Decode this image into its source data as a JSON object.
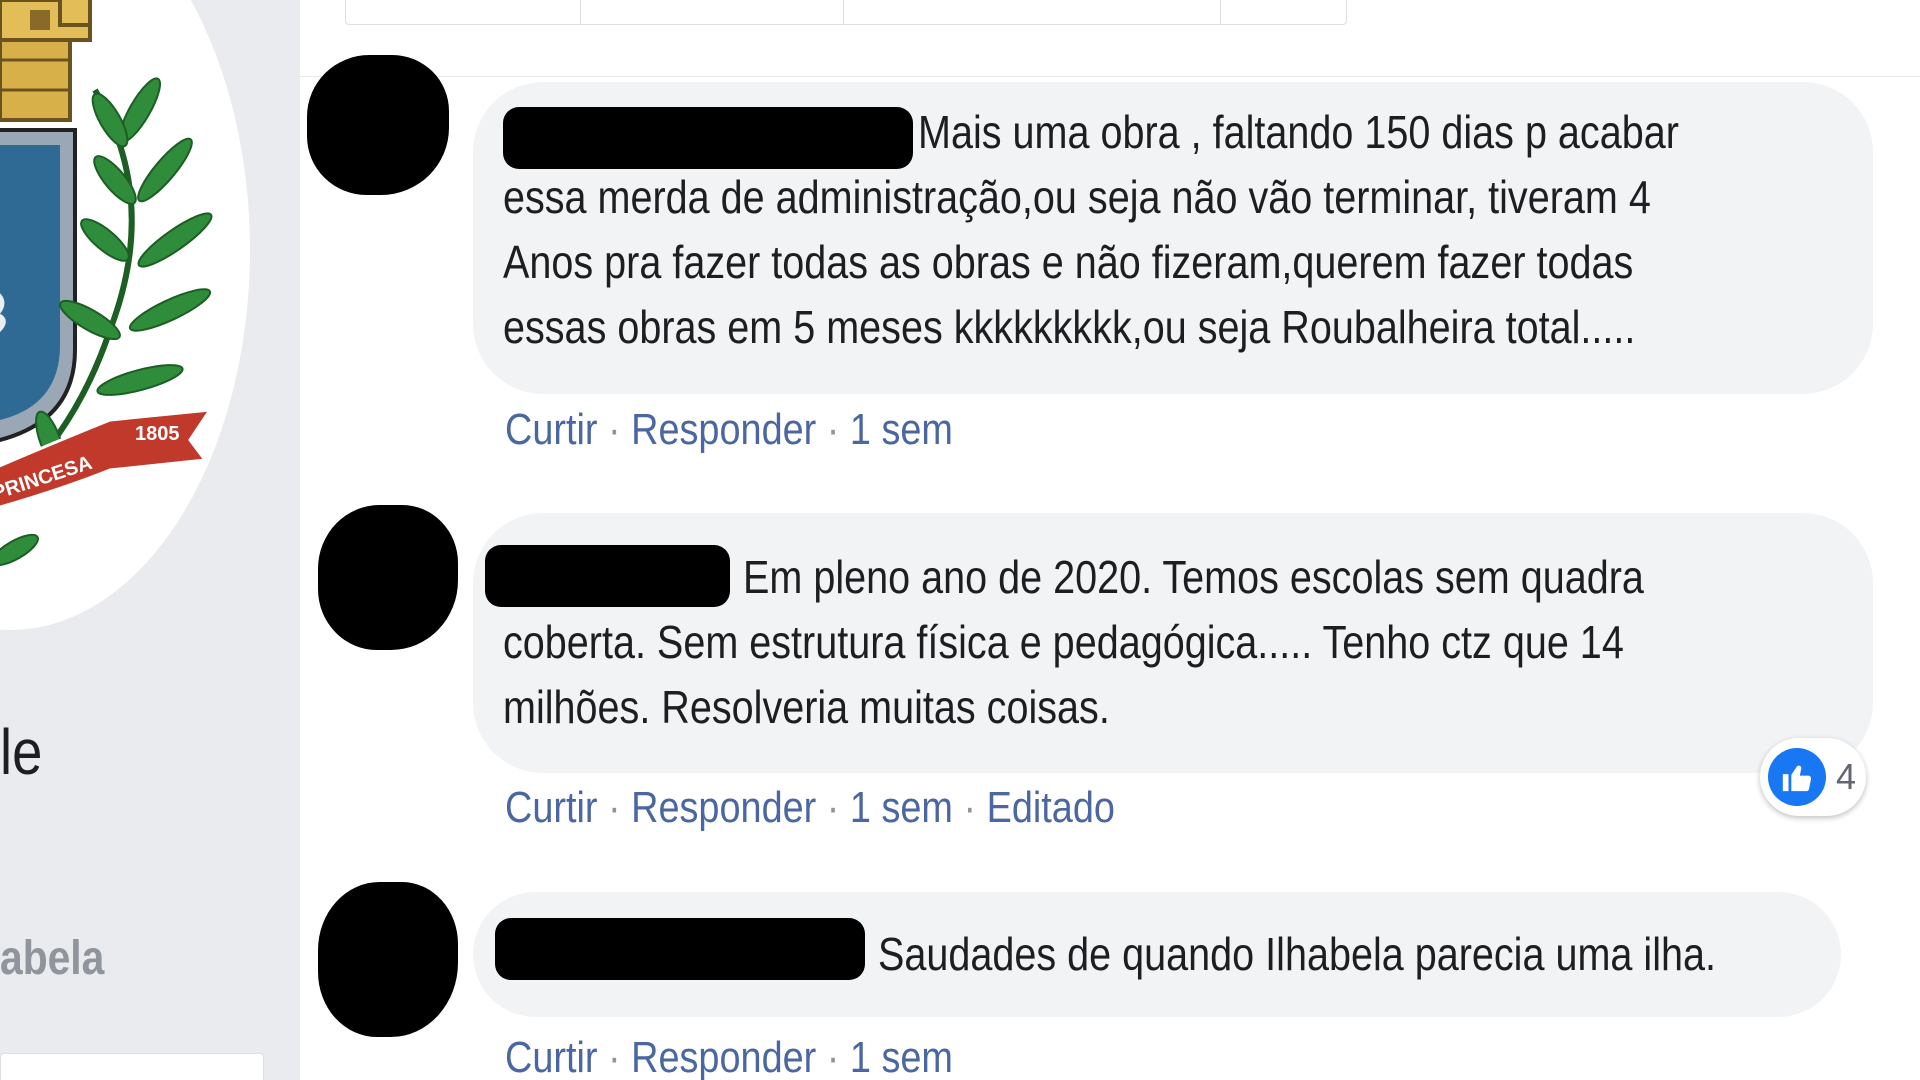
{
  "sidebar": {
    "partial_text_1": "le",
    "partial_text_2": "abela",
    "crest_ribbon_year": "1805",
    "crest_ribbon_text": "PRINCESA"
  },
  "comments": [
    {
      "text_lines": [
        "Mais uma obra , faltando 150 dias p acabar",
        "essa merda de administração,ou seja não vão terminar, tiveram 4",
        "Anos pra fazer todas as obras e não fizeram,querem fazer todas",
        "essas obras em 5 meses kkkkkkkkk,ou seja Roubalheira total....."
      ],
      "like_label": "Curtir",
      "reply_label": "Responder",
      "time": "1 sem"
    },
    {
      "text_lines": [
        "Em pleno ano de 2020. Temos escolas sem quadra",
        "coberta. Sem estrutura física e pedagógica..... Tenho ctz que 14",
        "milhões. Resolveria muitas coisas."
      ],
      "like_label": "Curtir",
      "reply_label": "Responder",
      "time": "1 sem",
      "edited_label": "Editado",
      "reaction_count": "4"
    },
    {
      "text_lines": [
        "Saudades de quando Ilhabela parecia uma ilha."
      ],
      "like_label": "Curtir",
      "reply_label": "Responder",
      "time": "1 sem"
    }
  ],
  "colors": {
    "link": "#4b67a1",
    "meta": "#90949c",
    "bubble": "#f2f3f5",
    "like_blue": "#1877f2"
  }
}
